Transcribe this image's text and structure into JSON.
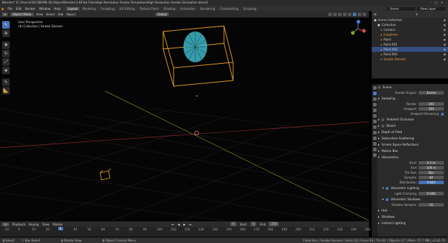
{
  "window": {
    "title": "Blender* [C:\\Users\\CDCOBURN 3D Object\\Blender\\1.BF.blk Files\\High Resolution Smoke Simulation\\High Resolution Smoke Simulation.blend]"
  },
  "menubar": {
    "menus": [
      "File",
      "Edit",
      "Render",
      "Window",
      "Help"
    ],
    "workspaces": [
      "Layout",
      "Modeling",
      "Sculpting",
      "UV Editing",
      "Texture Paint",
      "Shading",
      "Animation",
      "Rendering",
      "Compositing",
      "Scripting"
    ],
    "active_workspace": "Layout",
    "scene_value": "Scene",
    "layer_value": "View Layer"
  },
  "viewport_header": {
    "mode": "Object Mode",
    "menus": [
      "View",
      "Select",
      "Add",
      "Object"
    ],
    "orientation": "Global"
  },
  "viewport": {
    "info_line1": "User Perspective",
    "info_line2": "(4) Collection | Smoke Domain"
  },
  "outliner": {
    "header_value": "Scene Collection",
    "rows": [
      {
        "label": "Scene Collection",
        "indent": 0,
        "selected": false,
        "color": "#d0d0d0"
      },
      {
        "label": "Collection",
        "indent": 1,
        "selected": false,
        "color": "#d0d0d0"
      },
      {
        "label": "Camera",
        "indent": 2,
        "selected": false,
        "color": "#d0d0d0"
      },
      {
        "label": "Icosphere",
        "indent": 2,
        "selected": false,
        "color": "#f0a040"
      },
      {
        "label": "Point",
        "indent": 2,
        "selected": false,
        "color": "#d0d0d0"
      },
      {
        "label": "Point.001",
        "indent": 2,
        "selected": false,
        "color": "#d0d0d0"
      },
      {
        "label": "Point.002",
        "indent": 2,
        "selected": true,
        "color": "#d0d0d0"
      },
      {
        "label": "Point.003",
        "indent": 2,
        "selected": false,
        "color": "#d0d0d0"
      },
      {
        "label": "Smoke Domain",
        "indent": 2,
        "selected": false,
        "color": "#f0a040"
      }
    ]
  },
  "properties": {
    "search_placeholder": "",
    "scene_label": "Scene",
    "render_engine_label": "Render Engine",
    "render_engine_value": "Eevee",
    "sampling": "Sampling",
    "render_label": "Render",
    "render_value": "100",
    "viewport_label": "Viewport",
    "viewport_value": "100",
    "viewport_denoising": "Viewport Denoising",
    "sections_a": [
      "Ambient Occlusion",
      "Bloom",
      "Depth of Field",
      "Subsurface Scattering",
      "Screen Space Reflections",
      "Motion Blur"
    ],
    "volumetrics": "Volumetrics",
    "start_label": "Start",
    "start_value": "0.1 m",
    "end_label": "End",
    "end_value": "100 m",
    "tile_label": "Tile Size",
    "tile_value": "8px",
    "samples_label": "Samples",
    "samples_value": "64",
    "distribution_label": "Distribution",
    "distribution_value": "0.800",
    "vol_lighting": "Volumetric Lighting",
    "light_clamp_label": "Light Clamping",
    "light_clamp_value": "0.000",
    "vol_shadows": "Volumetric Shadows",
    "shadow_samples_label": "Shadow Samples",
    "shadow_samples_value": "16",
    "sections_b": [
      "Hair",
      "Shadows",
      "Indirect Lighting"
    ]
  },
  "timeline": {
    "menus": [
      "Playback",
      "Keying",
      "View",
      "Marker"
    ],
    "current_frame": "4",
    "start_label": "Start",
    "start_value": "1",
    "end_label": "End",
    "end_value": "250",
    "ticks": [
      "-10",
      "0",
      "10",
      "20",
      "30",
      "40",
      "50",
      "60",
      "70",
      "80",
      "90",
      "100",
      "110",
      "120",
      "130",
      "140",
      "150",
      "160",
      "170",
      "180",
      "190",
      "200",
      "210",
      "220",
      "230",
      "240",
      "250"
    ]
  },
  "statusbar": {
    "select": "Select",
    "box_select": "Box Select",
    "rotate_view": "Rotate View",
    "context_menu": "Object Context Menu",
    "stats": "Collection | Smoke Domain | Verts:33 | Faces:48 | Tris:92 | Objects:1/7 | Mem: 57.7 MB | v2.83.70"
  },
  "colors": {
    "accent": "#4772b3",
    "selection": "#f5a623",
    "grid_x": "#8a2b2b",
    "grid_y": "#7a8a24"
  }
}
